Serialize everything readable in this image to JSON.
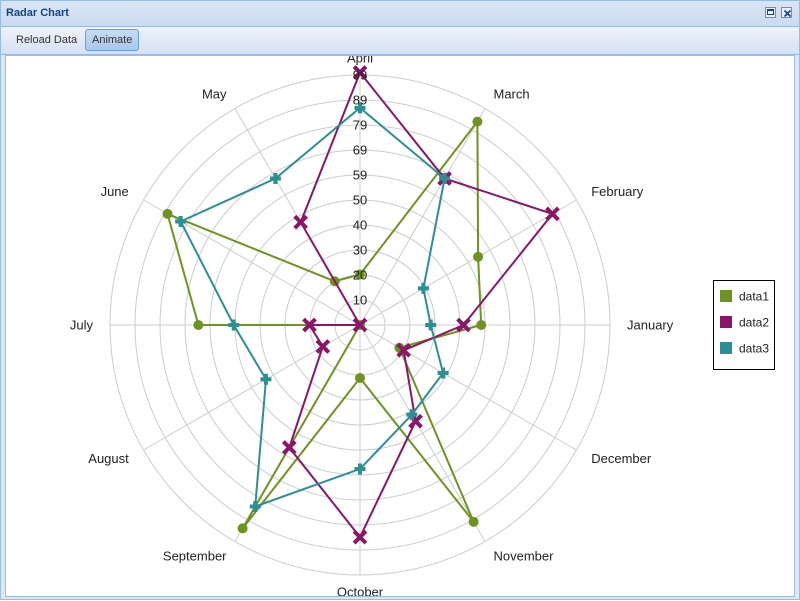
{
  "window": {
    "title": "Radar Chart"
  },
  "toolbar": {
    "reload_label": "Reload Data",
    "animate_label": "Animate"
  },
  "chart_data": {
    "type": "radar",
    "categories": [
      "January",
      "February",
      "March",
      "April",
      "May",
      "June",
      "July",
      "August",
      "September",
      "October",
      "November",
      "December"
    ],
    "radial_ticks": [
      "10",
      "20",
      "30",
      "40",
      "50",
      "59",
      "69",
      "79",
      "89",
      "99"
    ],
    "rmax": 99,
    "grid": true,
    "legend_position": "right",
    "series": [
      {
        "name": "data1",
        "color": "#6f9320",
        "marker": "circle",
        "values": [
          48,
          54,
          93,
          20,
          20,
          88,
          64,
          0,
          93,
          21,
          90,
          18
        ]
      },
      {
        "name": "data2",
        "color": "#8b1566",
        "marker": "x",
        "values": [
          41,
          88,
          67,
          100,
          47,
          0,
          20,
          17,
          56,
          84,
          44,
          20
        ]
      },
      {
        "name": "data3",
        "color": "#2c9093",
        "marker": "plus",
        "values": [
          28,
          29,
          67,
          86,
          67,
          82,
          50,
          43,
          83,
          57,
          41,
          38
        ]
      }
    ]
  }
}
